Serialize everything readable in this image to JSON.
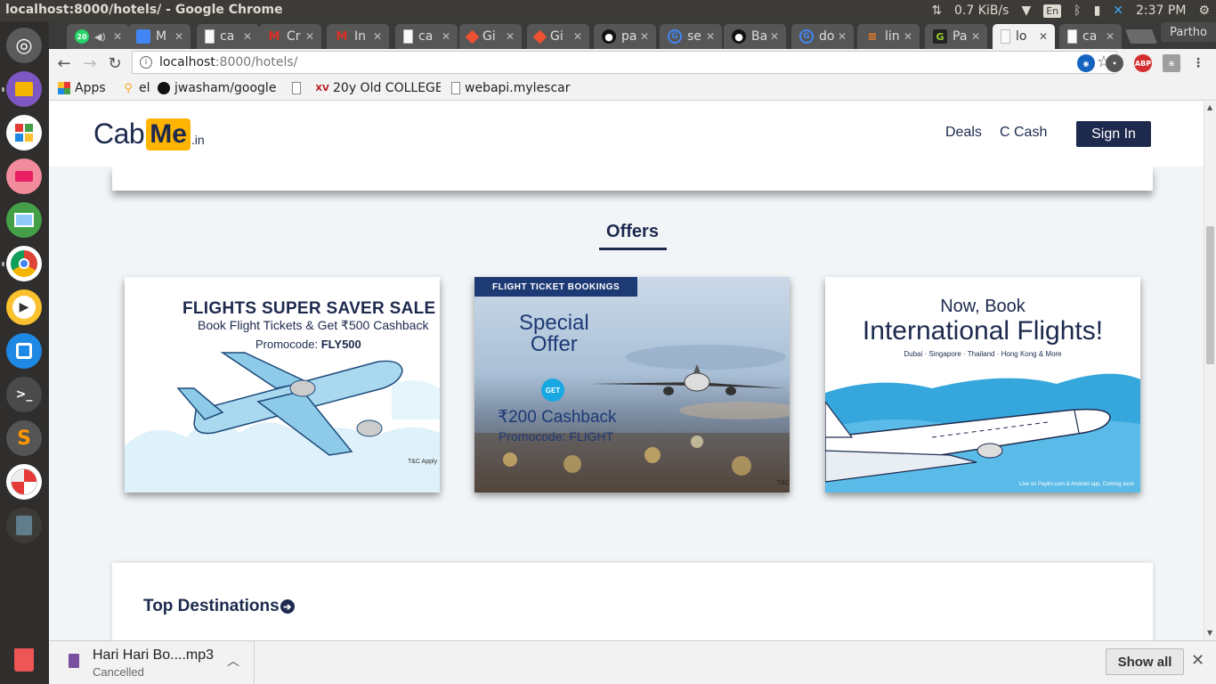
{
  "window_title": "localhost:8000/hotels/ - Google Chrome",
  "system_tray": {
    "net_speed": "0.7 KiB/s",
    "keyboard": "En",
    "clock": "2:37 PM",
    "user": "Partho"
  },
  "tabs": [
    {
      "label": "",
      "icon": "whatsapp-icon",
      "badge": "20"
    },
    {
      "label": "M",
      "icon": "doc-icon"
    },
    {
      "label": "ca",
      "icon": "page-icon"
    },
    {
      "label": "Cr",
      "icon": "gmail-icon"
    },
    {
      "label": "In",
      "icon": "gmail-icon"
    },
    {
      "label": "ca",
      "icon": "page-icon"
    },
    {
      "label": "Gi",
      "icon": "git-icon"
    },
    {
      "label": "Gi",
      "icon": "git-icon"
    },
    {
      "label": "pa",
      "icon": "github-icon"
    },
    {
      "label": "se",
      "icon": "google-icon"
    },
    {
      "label": "Ba",
      "icon": "github-icon"
    },
    {
      "label": "do",
      "icon": "google-icon"
    },
    {
      "label": "lin",
      "icon": "stackoverflow-icon"
    },
    {
      "label": "Pa",
      "icon": "app-icon"
    },
    {
      "label": "lo",
      "icon": "page-icon",
      "active": true
    },
    {
      "label": "ca",
      "icon": "page-icon"
    }
  ],
  "address_bar": {
    "host": "localhost",
    "path": ":8000/hotels/"
  },
  "bookmarks": [
    {
      "label": "Apps",
      "icon": "apps-grid-icon"
    },
    {
      "label": "el",
      "icon": "location-pin-icon"
    },
    {
      "label": "jwasham/google",
      "icon": "github-icon"
    },
    {
      "label": "",
      "icon": "page-icon"
    },
    {
      "label": "20y Old COLLEGE",
      "icon": "xv-icon"
    },
    {
      "label": "webapi.mylescar",
      "icon": "page-icon"
    }
  ],
  "site": {
    "logo": {
      "part1": "Cab",
      "part2": "Me",
      "part3": ".in"
    },
    "nav": {
      "deals": "Deals",
      "ccash": "C Cash",
      "signin": "Sign In"
    },
    "offers_heading": "Offers",
    "offers": [
      {
        "title": "FLIGHTS SUPER SAVER SALE",
        "subtitle": "Book Flight Tickets & Get ₹500 Cashback",
        "promo_prefix": "Promocode: ",
        "promo_code": "FLY500",
        "tc": "T&C Apply"
      },
      {
        "tag": "FLIGHT TICKET BOOKINGS",
        "headline1": "Special",
        "headline2": "Offer",
        "badge": "GET",
        "cashback": "₹200 Cashback",
        "promo": "Promocode: FLIGHT",
        "tc": "T&C"
      },
      {
        "line1": "Now, Book",
        "line2": "International Flights!",
        "cities": "Dubai · Singapore · Thailand · Hong Kong & More",
        "footnote": "Live on Paytm.com & Android app, Coming soon"
      }
    ],
    "top_destinations": "Top Destinations"
  },
  "download_shelf": {
    "file": "Hari Hari Bo....mp3",
    "status": "Cancelled",
    "show_all": "Show all"
  },
  "colors": {
    "brand_navy": "#1d2a4e",
    "brand_yellow": "#ffb400",
    "page_bg": "#f2f5f7"
  }
}
